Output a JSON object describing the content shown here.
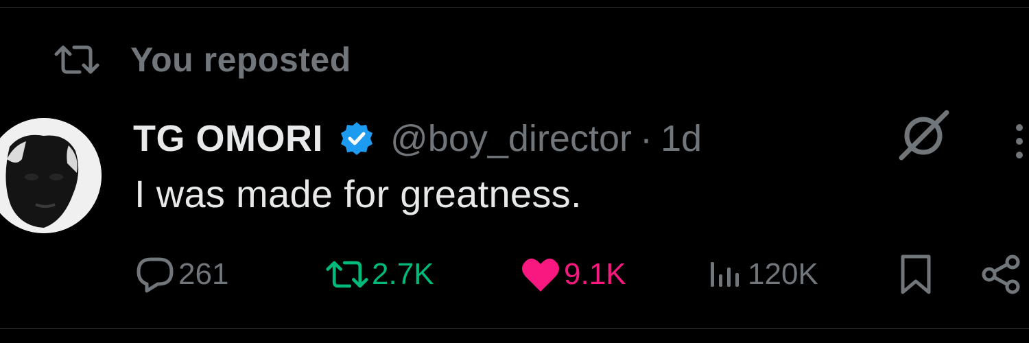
{
  "social_context": {
    "icon": "repost-icon",
    "label": "You reposted"
  },
  "post": {
    "author": {
      "display_name": "TG OMORI",
      "verified": true,
      "verified_color": "#1d9bf0",
      "handle": "@boy_director",
      "separator": "·",
      "time_ago": "1d"
    },
    "text": "I was made for greatness.",
    "actions": {
      "reply_count": "261",
      "repost_count": "2.7K",
      "repost_active": true,
      "repost_color": "#00ba7c",
      "like_count": "9.1K",
      "like_active": true,
      "like_color": "#f91880",
      "view_count": "120K"
    }
  },
  "icons": {
    "grok": "grok-icon",
    "more": "more-icon",
    "bookmark": "bookmark-icon",
    "share": "share-icon"
  }
}
